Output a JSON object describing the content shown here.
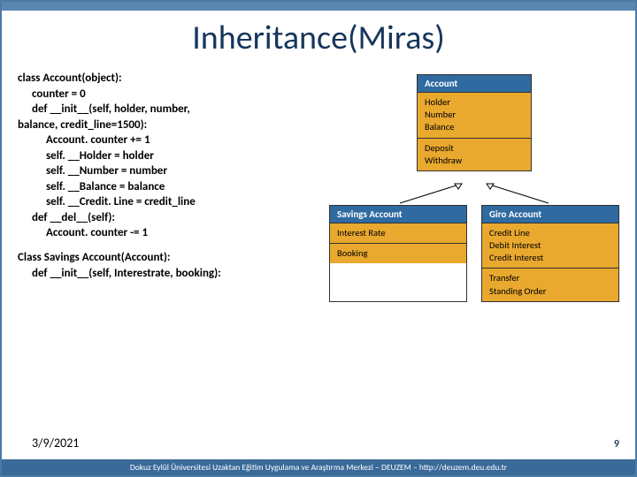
{
  "title": "Inheritance(Miras)",
  "code": {
    "l0": "class Account(object):",
    "l1": "counter = 0",
    "l2": "def __init__(self, holder, number,",
    "l2b": "balance, credit_line=1500):",
    "l3": "Account. counter += 1",
    "l4": "self. __Holder = holder",
    "l5": "self. __Number = number",
    "l6": "self. __Balance = balance",
    "l7": "self. __Credit. Line = credit_line",
    "l8": "def __del__(self):",
    "l9": "Account. counter -= 1",
    "l10": "Class Savings Account(Account):",
    "l11": "def __init__(self, Interestrate, booking):"
  },
  "diagram": {
    "account": {
      "head": "Account",
      "attrs": "Holder\nNumber\nBalance",
      "meth": "Deposit\nWithdraw"
    },
    "savings": {
      "head": "Savings Account",
      "attrs": "Interest Rate",
      "meth": "Booking"
    },
    "giro": {
      "head": "Giro Account",
      "attrs": "Credit Line\nDebit Interest\nCredit Interest",
      "meth": "Transfer\nStanding Order"
    }
  },
  "footer": {
    "date": "3/9/2021",
    "num": "9",
    "org": "Dokuz Eylül Üniversitesi Uzaktan Eğitim Uygulama ve Araştırma Merkezi – DEUZEM – http://deuzem.deu.edu.tr"
  }
}
